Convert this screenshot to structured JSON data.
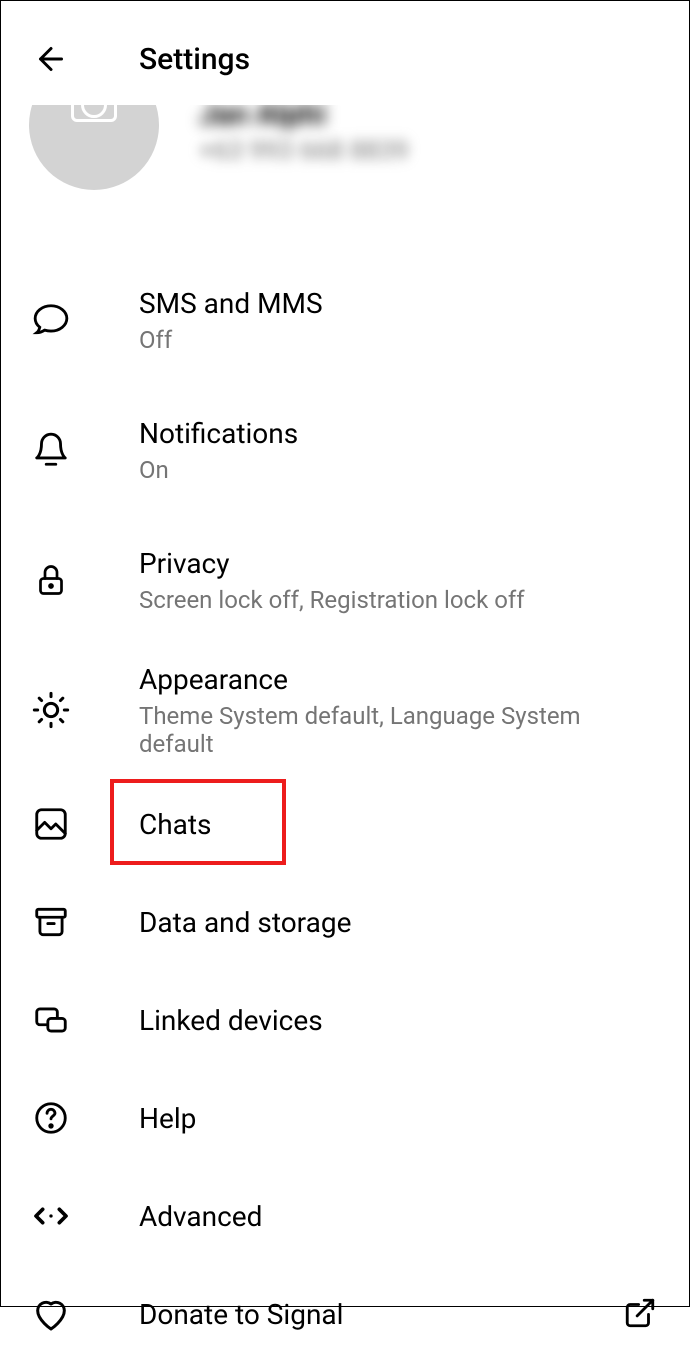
{
  "header": {
    "title": "Settings"
  },
  "profile": {
    "name": "Jan Alphi",
    "phone": "+63 993 668 8839"
  },
  "items": {
    "sms": {
      "label": "SMS and MMS",
      "sub": "Off"
    },
    "notifications": {
      "label": "Notifications",
      "sub": "On"
    },
    "privacy": {
      "label": "Privacy",
      "sub": "Screen lock off, Registration lock off"
    },
    "appearance": {
      "label": "Appearance",
      "sub": "Theme System default, Language System default"
    },
    "chats": {
      "label": "Chats"
    },
    "data": {
      "label": "Data and storage"
    },
    "linked": {
      "label": "Linked devices"
    },
    "help": {
      "label": "Help"
    },
    "advanced": {
      "label": "Advanced"
    },
    "donate": {
      "label": "Donate to Signal"
    }
  }
}
